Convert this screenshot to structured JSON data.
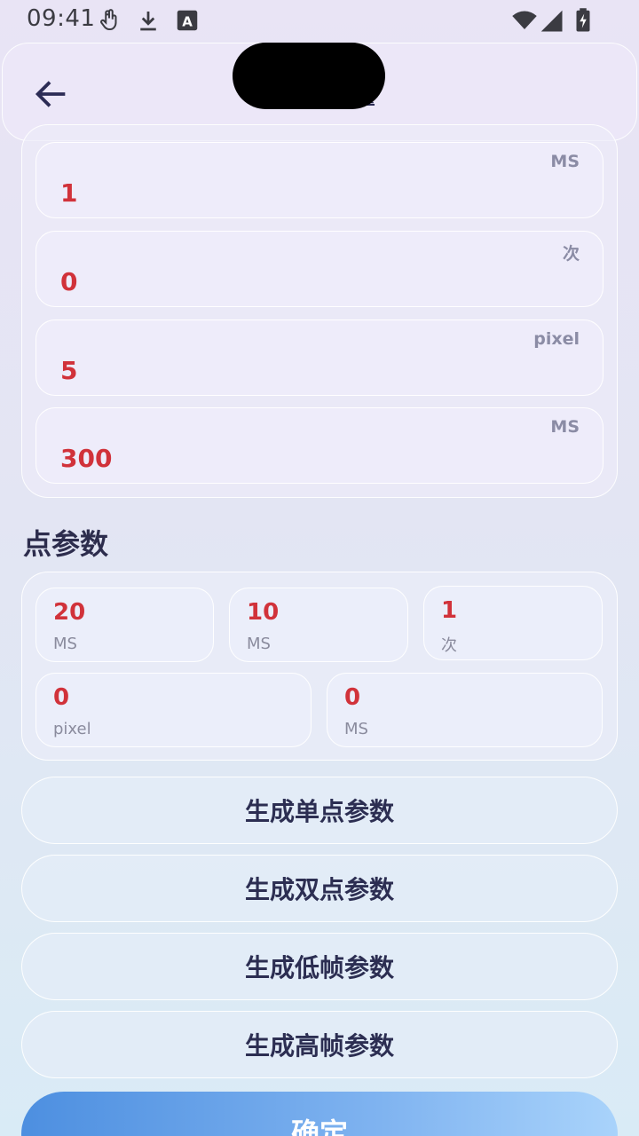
{
  "status_bar": {
    "time": "09:41",
    "icons": [
      "touch-icon",
      "download-icon",
      "font-icon",
      "wifi-icon",
      "signal-icon",
      "battery-charging-icon"
    ]
  },
  "app_bar": {
    "back_icon": "arrow-left-icon",
    "title_fragment": "置"
  },
  "upper_fields": [
    {
      "value": "1",
      "unit": "MS"
    },
    {
      "value": "0",
      "unit": "次"
    },
    {
      "value": "5",
      "unit": "pixel"
    },
    {
      "value": "300",
      "unit": "MS"
    }
  ],
  "point_params": {
    "title": "点参数",
    "fields": [
      {
        "value": "20",
        "unit": "MS"
      },
      {
        "value": "10",
        "unit": "MS"
      },
      {
        "value": "1",
        "unit": "次"
      },
      {
        "value": "0",
        "unit": "pixel"
      },
      {
        "value": "0",
        "unit": "MS"
      }
    ]
  },
  "buttons": {
    "single": "生成单点参数",
    "double": "生成双点参数",
    "low_frame": "生成低帧参数",
    "high_frame": "生成高帧参数",
    "confirm": "确定"
  },
  "colors": {
    "value_red": "#d1323a",
    "confirm_gradient_start": "#4d8fe0",
    "confirm_gradient_end": "#a9d3fb"
  }
}
